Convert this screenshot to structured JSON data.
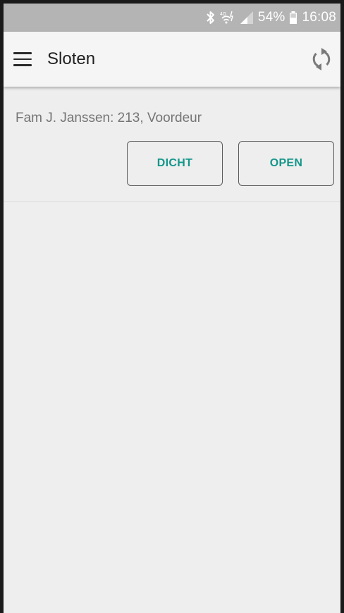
{
  "status_bar": {
    "battery_percent": "54%",
    "time": "16:08",
    "icons": [
      "bluetooth-icon",
      "mobile-data-icon",
      "signal-icon",
      "battery-icon"
    ]
  },
  "app_bar": {
    "title": "Sloten",
    "menu_icon": "menu-icon",
    "refresh_icon": "sync-icon"
  },
  "locks": [
    {
      "name": "Fam J. Janssen: 213, Voordeur",
      "close_label": "DICHT",
      "open_label": "OPEN"
    }
  ],
  "colors": {
    "accent": "#14968a",
    "status_bar": "#b4b4b4",
    "app_bar": "#f5f5f5",
    "background": "#eeeeee"
  }
}
